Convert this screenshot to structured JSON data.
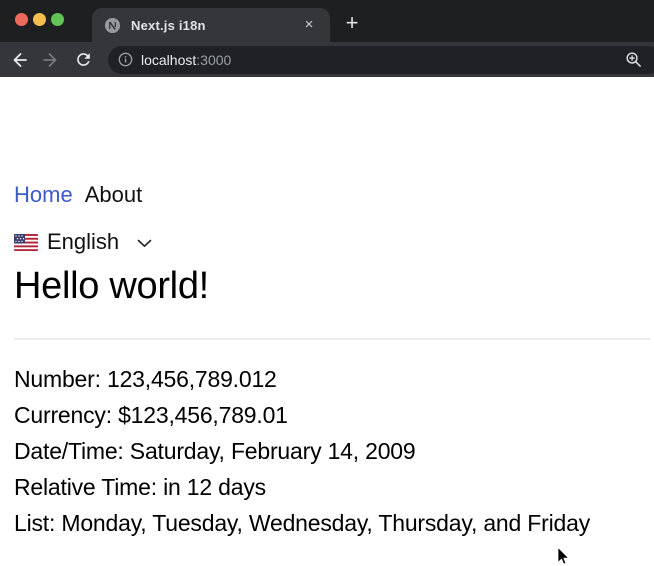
{
  "browser": {
    "tab_title": "Next.js i18n",
    "close_tab_glyph": "×",
    "new_tab_glyph": "+",
    "url_host": "localhost",
    "url_port": ":3000"
  },
  "nav": {
    "home": "Home",
    "about": "About"
  },
  "language": {
    "label": "English",
    "flag": "us-flag-icon"
  },
  "main": {
    "heading": "Hello world!",
    "lines": [
      "Number: 123,456,789.012",
      "Currency: $123,456,789.01",
      "Date/Time: Saturday, February 14, 2009",
      "Relative Time: in 12 days",
      "List: Monday, Tuesday, Wednesday, Thursday, and Friday"
    ]
  },
  "icons": {
    "favicon": "nextjs-globe-icon",
    "back": "back-arrow-icon",
    "forward": "forward-arrow-icon",
    "reload": "reload-icon",
    "site_info": "info-icon",
    "zoom": "zoom-in-magnifier-icon",
    "language_chevron": "chevron-down-icon",
    "pointer": "mouse-cursor"
  },
  "colors": {
    "frame": "#1e1f21",
    "toolbar": "#35363a",
    "omnibox": "#202124",
    "link_blue": "#3b5cc9",
    "traffic_red": "#ec6a5e",
    "traffic_yellow": "#f4bf4f",
    "traffic_green": "#61c454",
    "divider": "#ececec"
  }
}
